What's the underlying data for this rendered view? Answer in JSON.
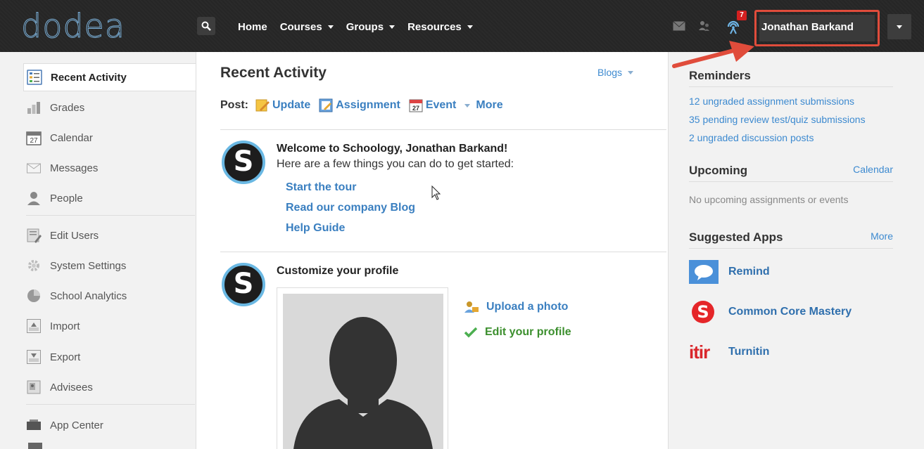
{
  "header": {
    "logo": "dodea",
    "nav": [
      {
        "label": "Home",
        "dropdown": false
      },
      {
        "label": "Courses",
        "dropdown": true
      },
      {
        "label": "Groups",
        "dropdown": true
      },
      {
        "label": "Resources",
        "dropdown": true
      }
    ],
    "notification_count": "7",
    "user_name": "Jonathan Barkand"
  },
  "sidebar": {
    "items": [
      {
        "label": "Recent Activity",
        "icon": "recent-activity-icon",
        "active": true
      },
      {
        "label": "Grades",
        "icon": "grades-icon"
      },
      {
        "label": "Calendar",
        "icon": "calendar-icon"
      },
      {
        "label": "Messages",
        "icon": "messages-icon"
      },
      {
        "label": "People",
        "icon": "people-icon"
      },
      {
        "label": "Edit Users",
        "icon": "edit-users-icon"
      },
      {
        "label": "System Settings",
        "icon": "settings-icon"
      },
      {
        "label": "School Analytics",
        "icon": "analytics-icon"
      },
      {
        "label": "Import",
        "icon": "import-icon"
      },
      {
        "label": "Export",
        "icon": "export-icon"
      },
      {
        "label": "Advisees",
        "icon": "advisees-icon"
      },
      {
        "label": "App Center",
        "icon": "app-center-icon"
      }
    ],
    "calendar_day": "27"
  },
  "main": {
    "title": "Recent Activity",
    "blogs_label": "Blogs",
    "post": {
      "label": "Post:",
      "update": "Update",
      "assignment": "Assignment",
      "event": "Event",
      "event_icon_day": "27",
      "more": "More"
    },
    "welcome": {
      "title": "Welcome to Schoology, Jonathan Barkand!",
      "subtitle": "Here are a few things you can do to get started:",
      "links": [
        "Start the tour",
        "Read our company Blog",
        "Help Guide"
      ]
    },
    "avatar_letter": "S",
    "profile": {
      "title": "Customize your profile",
      "upload": "Upload a photo",
      "edit": "Edit your profile"
    }
  },
  "right": {
    "reminders": {
      "title": "Reminders",
      "items": [
        "12 ungraded assignment submissions",
        "35 pending review test/quiz submissions",
        "2 ungraded discussion posts"
      ]
    },
    "upcoming": {
      "title": "Upcoming",
      "link": "Calendar",
      "empty": "No upcoming assignments or events"
    },
    "apps": {
      "title": "Suggested Apps",
      "more": "More",
      "items": [
        {
          "name": "Remind",
          "icon": "remind-icon"
        },
        {
          "name": "Common Core Mastery",
          "icon": "common-core-icon",
          "icon_letter": "S"
        },
        {
          "name": "Turnitin",
          "icon": "turnitin-icon",
          "icon_text": "itir"
        }
      ]
    }
  },
  "colors": {
    "accent": "#3a7fc0",
    "topbar": "#262626",
    "highlight": "#e04c3b",
    "badge": "#d42020",
    "success": "#3c8f2e"
  }
}
